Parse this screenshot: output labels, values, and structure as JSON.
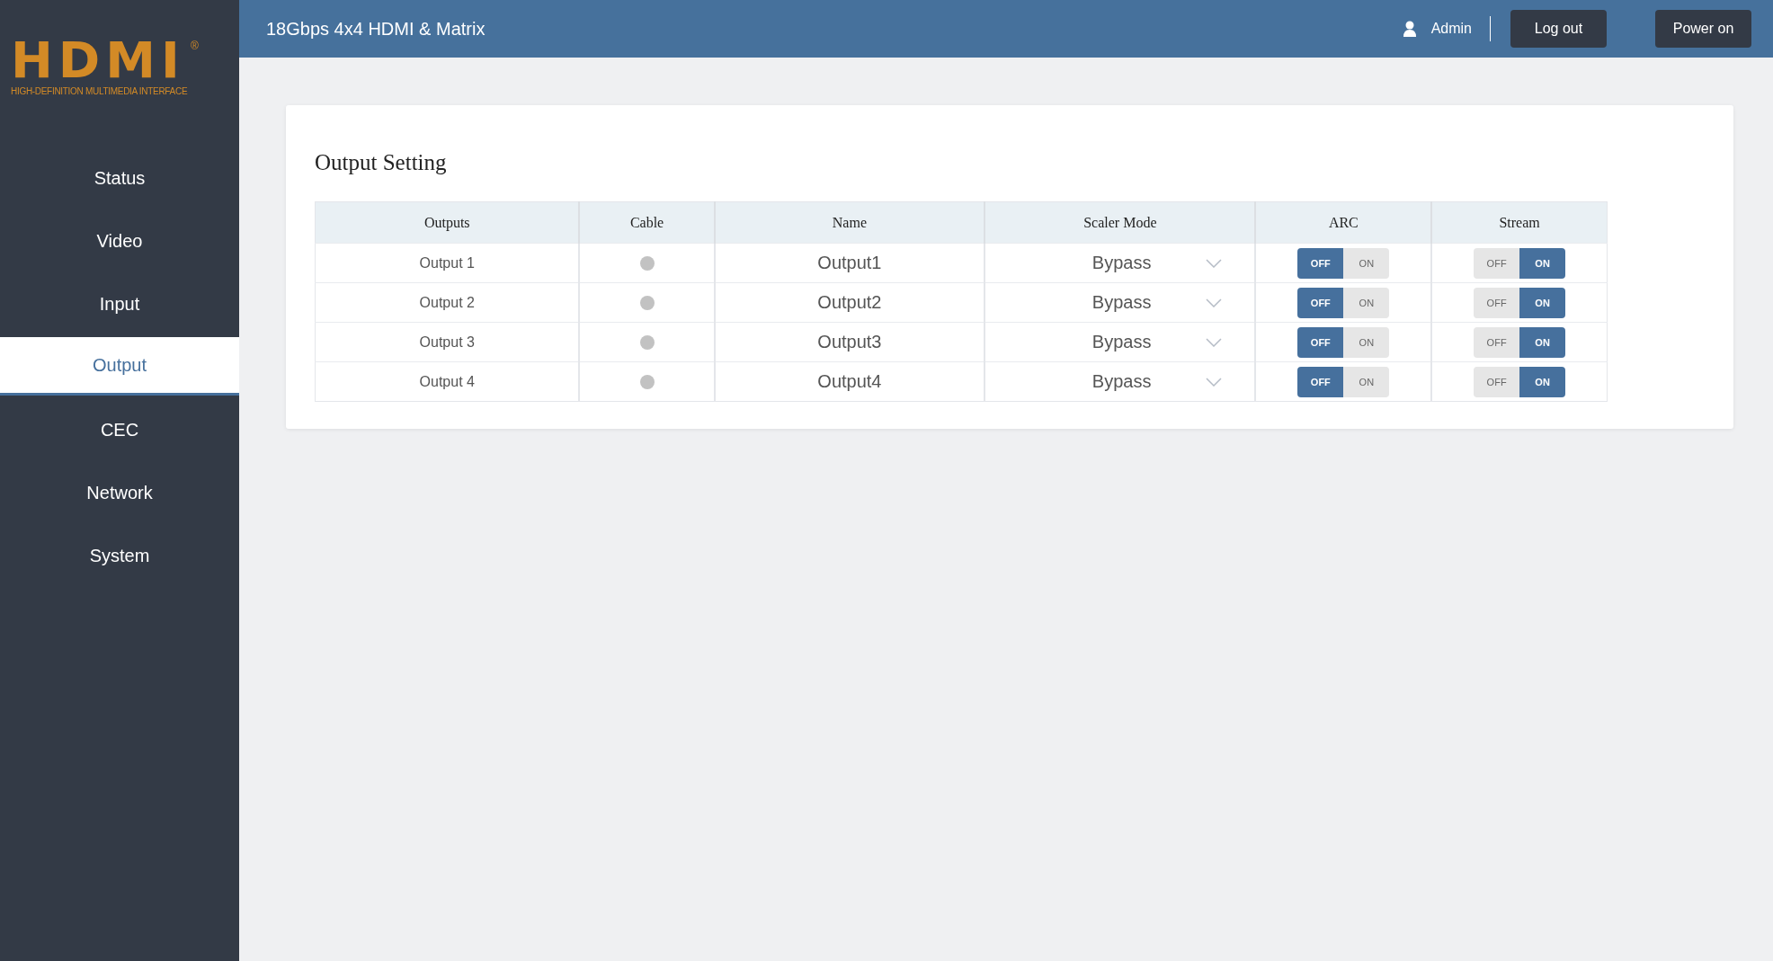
{
  "logo": {
    "wordmark": "HDMI",
    "registered": "®",
    "tagline": "HIGH-DEFINITION MULTIMEDIA INTERFACE"
  },
  "sidebar": {
    "items": [
      {
        "label": "Status",
        "selected": false
      },
      {
        "label": "Video",
        "selected": false
      },
      {
        "label": "Input",
        "selected": false
      },
      {
        "label": "Output",
        "selected": true
      },
      {
        "label": "CEC",
        "selected": false
      },
      {
        "label": "Network",
        "selected": false
      },
      {
        "label": "System",
        "selected": false
      }
    ]
  },
  "header": {
    "title": "18Gbps 4x4 HDMI & Matrix",
    "user": "Admin",
    "buttons": [
      "Log out",
      "Power on"
    ]
  },
  "panel": {
    "title": "Output Setting",
    "table": {
      "columns": [
        "Outputs",
        "Cable",
        "Name",
        "Scaler Mode",
        "ARC",
        "Stream"
      ],
      "rows": [
        {
          "output": "Output 1",
          "cable_connected": false,
          "name": "Output1",
          "scaler_mode": "Bypass",
          "arc": {
            "off_label": "OFF",
            "on_label": "ON",
            "on": false
          },
          "stream": {
            "off_label": "OFF",
            "on_label": "ON",
            "on": true
          }
        },
        {
          "output": "Output 2",
          "cable_connected": false,
          "name": "Output2",
          "scaler_mode": "Bypass",
          "arc": {
            "off_label": "OFF",
            "on_label": "ON",
            "on": false
          },
          "stream": {
            "off_label": "OFF",
            "on_label": "ON",
            "on": true
          }
        },
        {
          "output": "Output 3",
          "cable_connected": false,
          "name": "Output3",
          "scaler_mode": "Bypass",
          "arc": {
            "off_label": "OFF",
            "on_label": "ON",
            "on": false
          },
          "stream": {
            "off_label": "OFF",
            "on_label": "ON",
            "on": true
          }
        },
        {
          "output": "Output 4",
          "cable_connected": false,
          "name": "Output4",
          "scaler_mode": "Bypass",
          "arc": {
            "off_label": "OFF",
            "on_label": "ON",
            "on": false
          },
          "stream": {
            "off_label": "OFF",
            "on_label": "ON",
            "on": true
          }
        }
      ]
    }
  }
}
